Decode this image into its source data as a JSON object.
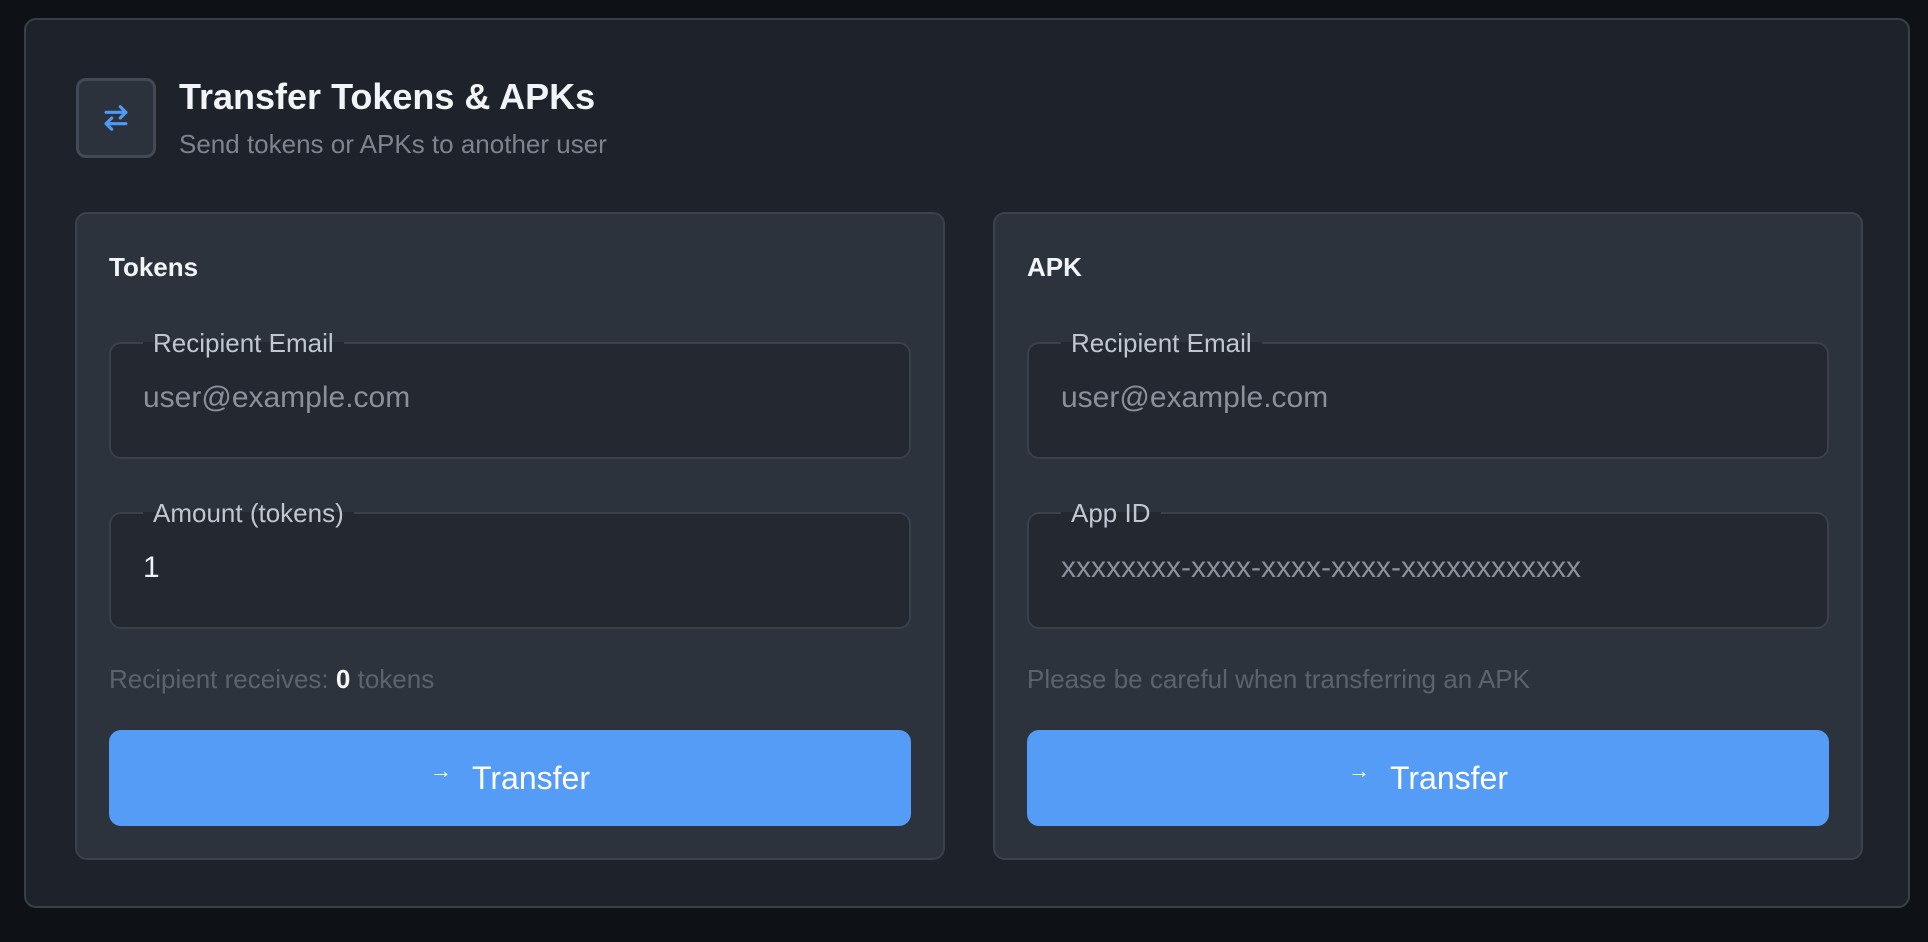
{
  "header": {
    "icon": "swap-arrows-icon",
    "title": "Transfer Tokens & APKs",
    "subtitle": "Send tokens or APKs to another user"
  },
  "tokens_card": {
    "title": "Tokens",
    "recipient_label": "Recipient Email",
    "recipient_placeholder": "user@example.com",
    "recipient_value": "",
    "amount_label": "Amount (tokens)",
    "amount_value": "1",
    "receives_prefix": "Recipient receives:",
    "receives_amount": "0",
    "receives_suffix": "tokens",
    "button_icon": "arrow-right-icon",
    "button_label": "Transfer"
  },
  "apk_card": {
    "title": "APK",
    "recipient_label": "Recipient Email",
    "recipient_placeholder": "user@example.com",
    "recipient_value": "",
    "appid_label": "App ID",
    "appid_placeholder": "xxxxxxxx-xxxx-xxxx-xxxx-xxxxxxxxxxxx",
    "appid_value": "",
    "warning": "Please be careful when transferring an APK",
    "button_icon": "arrow-right-icon",
    "button_label": "Transfer"
  },
  "colors": {
    "page_bg": "#0e1216",
    "panel_bg": "#1e222a",
    "card_bg": "#2d333c",
    "input_bg": "#232831",
    "accent": "#559cf6",
    "icon_accent": "#4f9af5"
  }
}
